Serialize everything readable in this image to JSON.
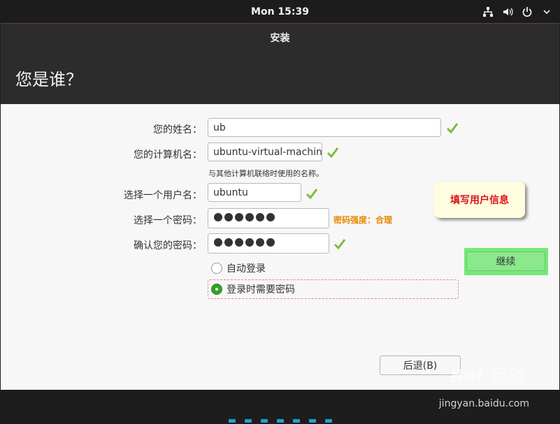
{
  "topbar": {
    "clock": "Mon 15:39",
    "icons": [
      "network-icon",
      "volume-icon",
      "power-icon",
      "chevron-down-icon"
    ]
  },
  "window": {
    "title": "安装",
    "page_title": "您是谁？"
  },
  "form": {
    "name_label": "您的姓名：",
    "name_value": "ub",
    "computer_label": "您的计算机名：",
    "computer_value": "ubuntu-virtual-machine",
    "computer_hint": "与其他计算机联络时使用的名称。",
    "username_label": "选择一个用户名：",
    "username_value": "ubuntu",
    "password_label": "选择一个密码：",
    "password_masked_length": 6,
    "password_strength": "密码强度：合理",
    "confirm_label": "确认您的密码：",
    "confirm_masked_length": 6,
    "login_options": [
      {
        "label": "自动登录",
        "selected": false
      },
      {
        "label": "登录时需要密码",
        "selected": true
      }
    ]
  },
  "callout": {
    "text": "填写用户信息"
  },
  "buttons": {
    "back": "后退(B)",
    "continue": "继续"
  },
  "progress": {
    "steps": 7
  },
  "watermark": {
    "text": "Bai 经验",
    "url": "jingyan.baidu.com"
  },
  "colors": {
    "accent_green": "#33a02c",
    "check_green": "#7dbb3a",
    "strength_orange": "#e68a00",
    "callout_red": "#e0121b",
    "progress_blue": "#19a3dd"
  }
}
